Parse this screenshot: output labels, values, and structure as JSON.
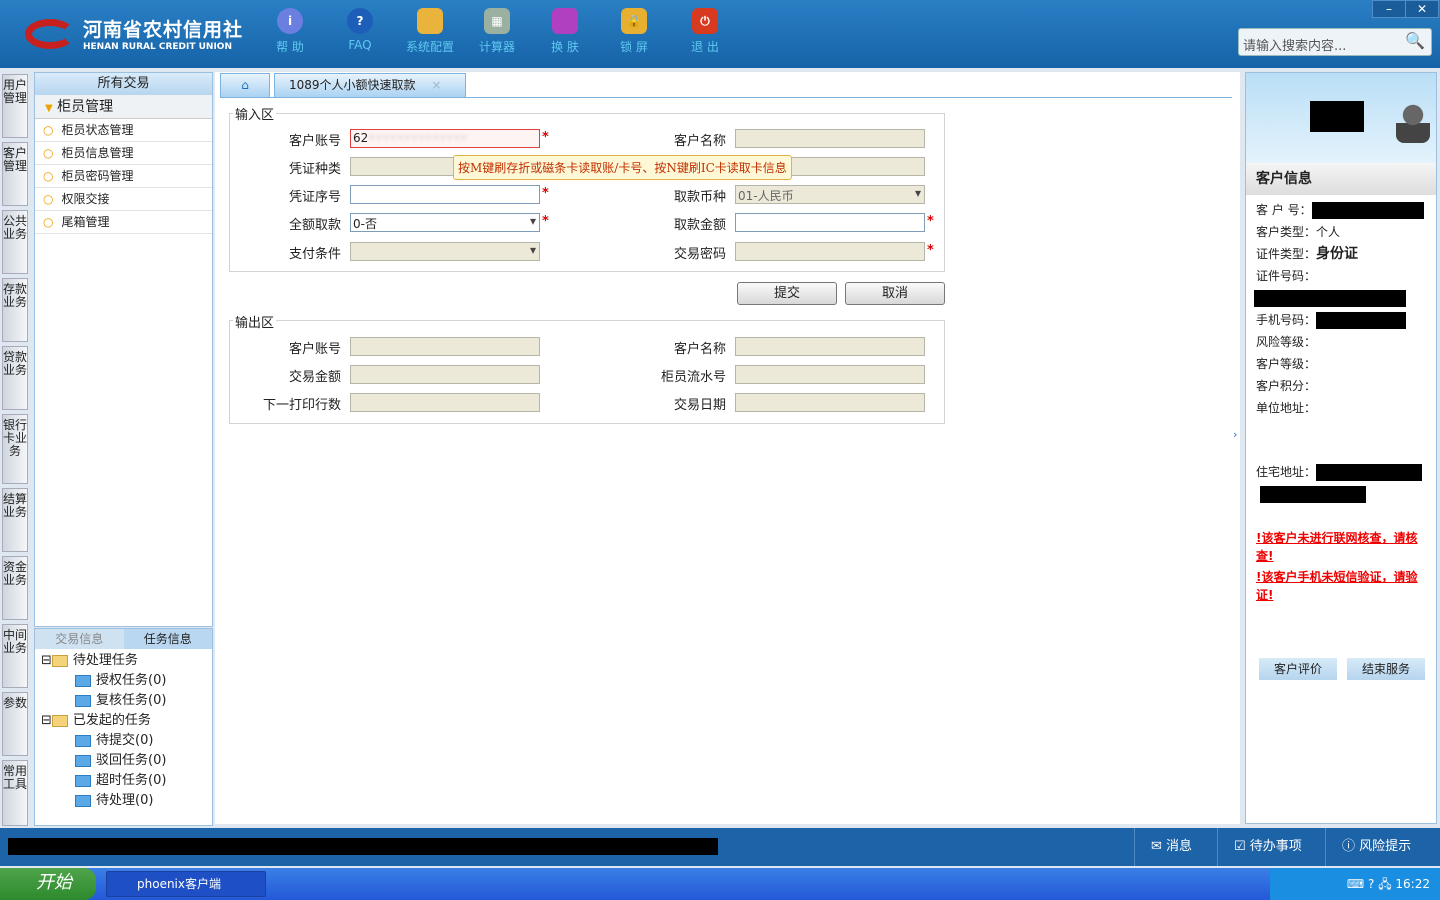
{
  "header": {
    "logo_cn": "河南省农村信用社",
    "logo_en": "HENAN RURAL CREDIT UNION",
    "tools": [
      {
        "label": "帮 助",
        "icon": "info-icon"
      },
      {
        "label": "FAQ",
        "icon": "question-icon"
      },
      {
        "label": "系统配置",
        "icon": "toolbox-icon"
      },
      {
        "label": "计算器",
        "icon": "calculator-icon"
      },
      {
        "label": "换 肤",
        "icon": "shirt-icon"
      },
      {
        "label": "锁 屏",
        "icon": "lock-icon"
      },
      {
        "label": "退 出",
        "icon": "power-icon"
      }
    ],
    "search_placeholder": "请输入搜索内容...",
    "minimize": "–",
    "close": "✕"
  },
  "vtabs": [
    "用户管理",
    "客户管理",
    "公共业务",
    "存款业务",
    "贷款业务",
    "银行卡业务",
    "结算业务",
    "资金业务",
    "中间业务",
    "参数",
    "常用工具"
  ],
  "leftpanel": {
    "header": "所有交易",
    "group": "柜员管理",
    "items": [
      "柜员状态管理",
      "柜员信息管理",
      "柜员密码管理",
      "权限交接",
      "尾箱管理"
    ]
  },
  "taskpanel": {
    "tabs": [
      "交易信息",
      "任务信息"
    ],
    "pending": "待处理任务",
    "pending_items": [
      "授权任务(0)",
      "复核任务(0)"
    ],
    "initiated": "已发起的任务",
    "initiated_items": [
      "待提交(0)",
      "驳回任务(0)",
      "超时任务(0)",
      "待处理(0)"
    ]
  },
  "tabs": {
    "active": "1089个人小额快速取款",
    "close": "×"
  },
  "input_area": {
    "legend": "输入区",
    "account_label": "客户账号",
    "account_value": "62",
    "name_label": "客户名称",
    "voucher_type_label": "凭证种类",
    "voucher_no_label": "凭证序号",
    "currency_label": "取款币种",
    "currency_value": "01-人民币",
    "full_label": "全额取款",
    "full_value": "0-否",
    "amount_label": "取款金额",
    "pay_cond_label": "支付条件",
    "password_label": "交易密码",
    "tooltip": "按M键刷存折或磁条卡读取账/卡号、按N键刷IC卡读取卡信息"
  },
  "buttons": {
    "submit": "提交",
    "cancel": "取消"
  },
  "output_area": {
    "legend": "输出区",
    "account_label": "客户账号",
    "name_label": "客户名称",
    "amount_label": "交易金额",
    "serial_label": "柜员流水号",
    "print_label": "下一打印行数",
    "date_label": "交易日期"
  },
  "customer": {
    "title": "客户信息",
    "no_label": "客 户 号：",
    "type_label": "客户类型：",
    "type_value": "个人",
    "id_type_label": "证件类型：",
    "id_type_value": "身份证",
    "id_no_label": "证件号码：",
    "phone_label": "手机号码：",
    "risk_label": "风险等级：",
    "level_label": "客户等级：",
    "points_label": "客户积分：",
    "work_addr_label": "单位地址：",
    "home_addr_label": "住宅地址：",
    "warn1": "!该客户未进行联网核查，请核查!",
    "warn2": "!该客户手机未短信验证，请验证!",
    "eval_btn": "客户评价",
    "end_btn": "结束服务"
  },
  "statusbar": {
    "messages": "消息",
    "todo": "待办事项",
    "risk": "风险提示"
  },
  "taskbar": {
    "start": "开始",
    "app": "phoenix客户端",
    "time": "16:22"
  }
}
